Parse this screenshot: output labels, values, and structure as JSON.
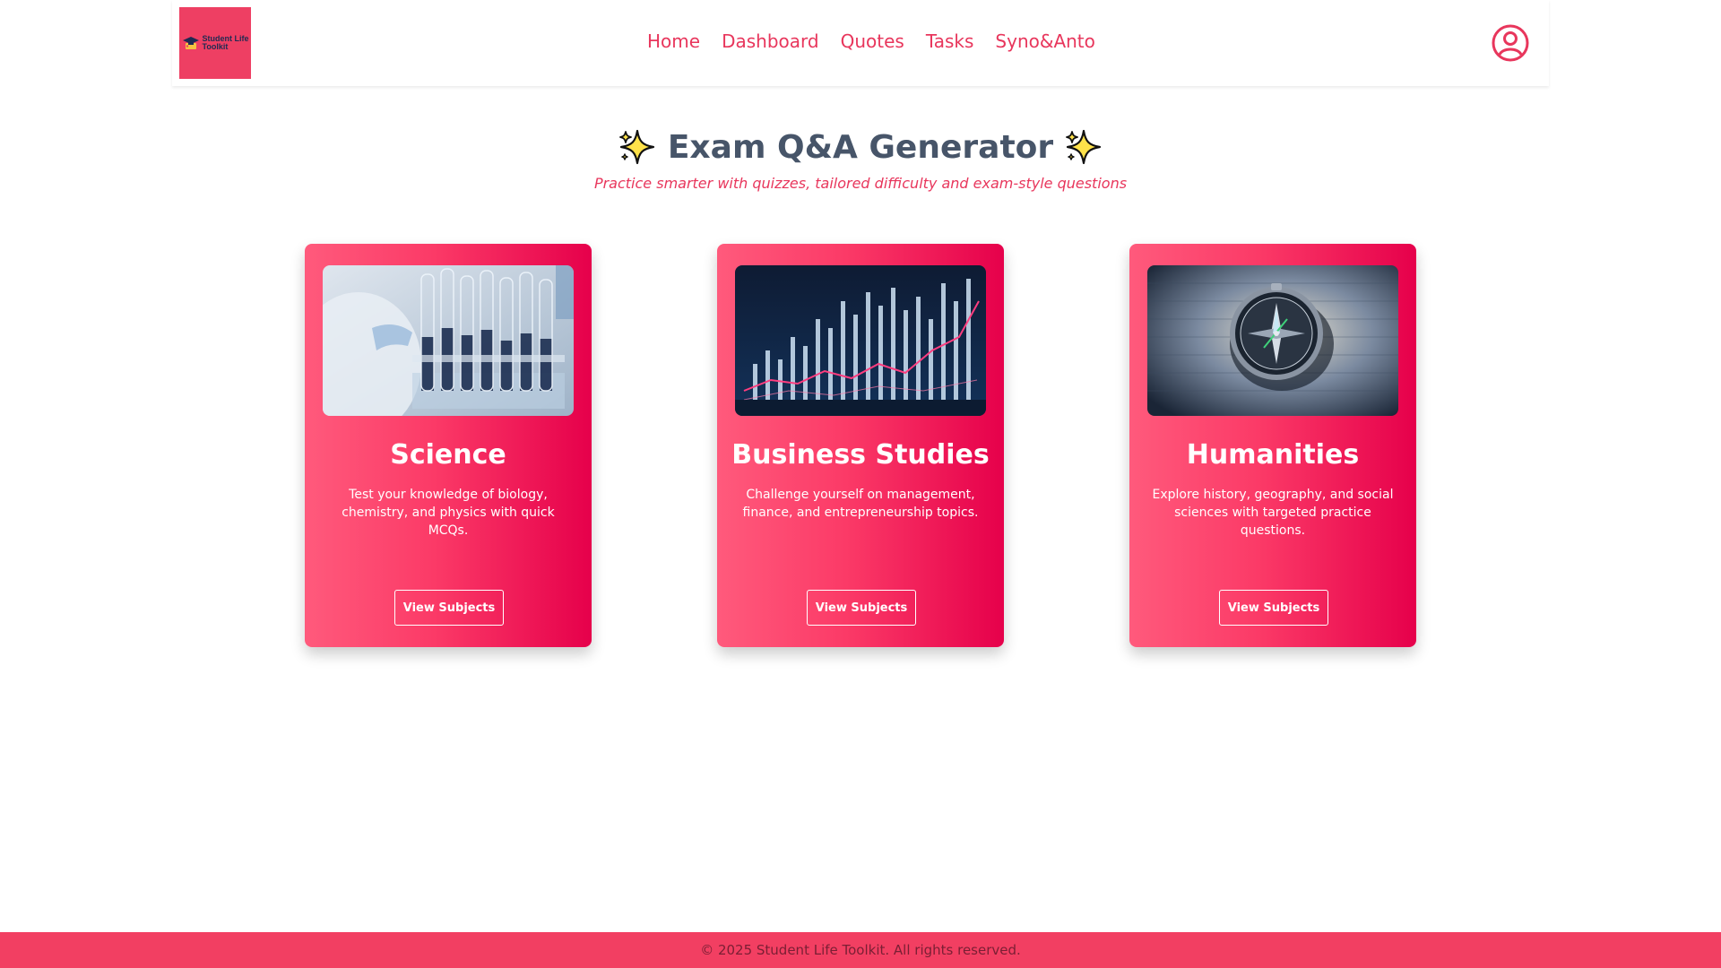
{
  "brand": {
    "logo_line1": "Student Life",
    "logo_line2": "Toolkit",
    "accent": "#e8365c"
  },
  "nav": {
    "items": [
      {
        "label": "Home"
      },
      {
        "label": "Dashboard"
      },
      {
        "label": "Quotes"
      },
      {
        "label": "Tasks"
      },
      {
        "label": "Syno&Anto"
      }
    ],
    "profile_icon": "user-circle-icon"
  },
  "hero": {
    "title": "Exam Q&A Generator",
    "subtitle": "Practice smarter with quizzes, tailored difficulty and exam-style questions",
    "icon": "sparkles-icon"
  },
  "cards": [
    {
      "title": "Science",
      "description": "Test your knowledge of biology, chemistry, and physics with quick MCQs.",
      "button": "View Subjects",
      "image": "test-tubes-photo"
    },
    {
      "title": "Business Studies",
      "description": "Challenge yourself on management, finance, and entrepreneurship topics.",
      "button": "View Subjects",
      "image": "financial-chart-photo"
    },
    {
      "title": "Humanities",
      "description": "Explore history, geography, and social sciences with targeted practice questions.",
      "button": "View Subjects",
      "image": "compass-photo"
    }
  ],
  "footer": {
    "text": "© 2025 Student Life Toolkit. All rights reserved."
  }
}
